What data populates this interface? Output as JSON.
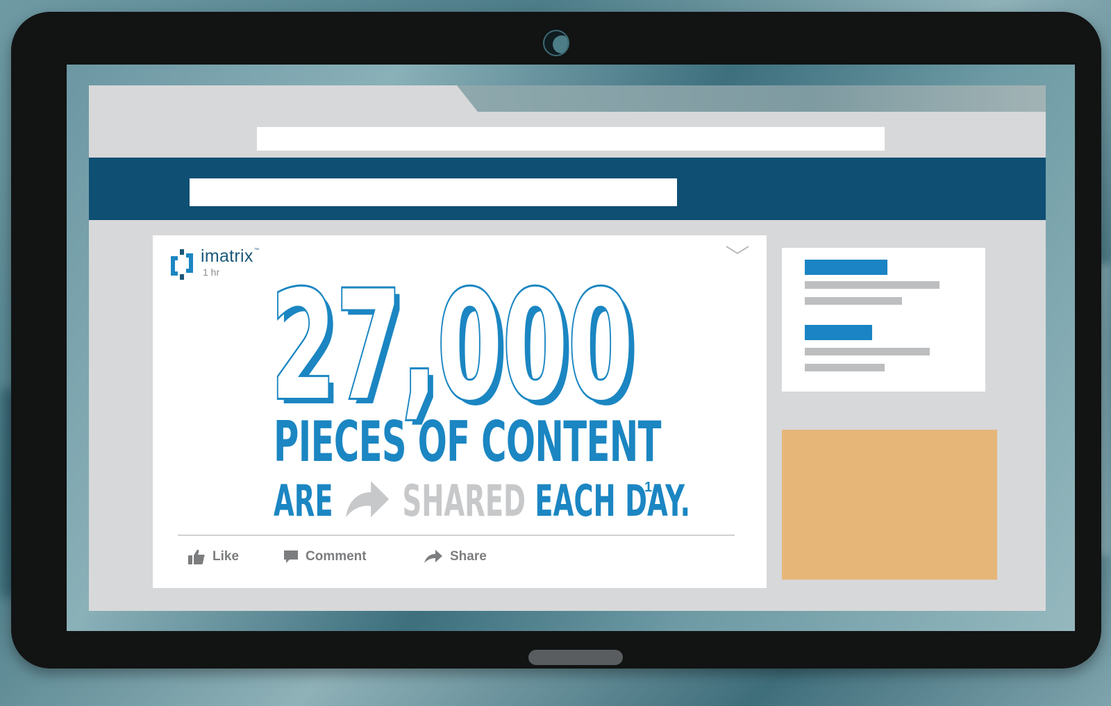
{
  "post": {
    "brand": "imatrix",
    "brand_tm": "™",
    "time": "1 hr",
    "big_number": "27,000",
    "headline_line1": "PIECES OF CONTENT",
    "headline_are": "ARE",
    "headline_shared": "SHARED",
    "headline_rest": "EACH DAY.",
    "footnote": "1",
    "actions": {
      "like": "Like",
      "comment": "Comment",
      "share": "Share"
    }
  },
  "colors": {
    "accent": "#1b86c2",
    "header": "#0e4f73",
    "shared_gray": "#c7c8ca",
    "ad": "#e6b679"
  },
  "icons": [
    "imatrix-logo-icon",
    "chevron-down-icon",
    "thumbs-up-icon",
    "comment-icon",
    "share-arrow-icon"
  ]
}
